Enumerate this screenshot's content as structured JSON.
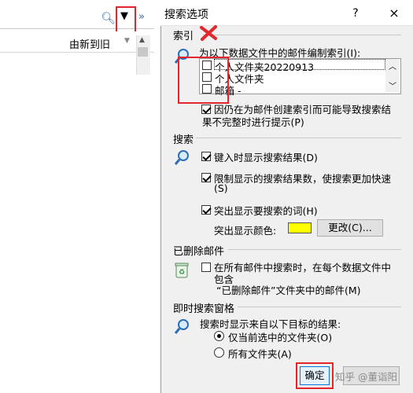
{
  "background": {
    "column_header": "由新到旧"
  },
  "dialog": {
    "title": "搜索选项",
    "help_label": "?",
    "close_label": "×",
    "index": {
      "section_title": "索引",
      "desc": "为以下数据文件中的邮件编制索引(I):",
      "items": [
        "个人文件夹20220913",
        "个人文件夹",
        "邮箱 -"
      ],
      "prompt_label": "因仍在为邮件创建索引而可能导致搜索结果不完整时进行提示(P)",
      "prompt_line1": "因仍在为邮件创建索引而可能导致搜索结",
      "prompt_line2": "果不完整时进行提示(P)"
    },
    "search": {
      "section_title": "搜索",
      "show_results_label": "键入时显示搜索结果(D)",
      "limit_line1": "限制显示的搜索结果数，使搜索更加快速",
      "limit_line2": "(S)",
      "highlight_label": "突出显示要搜索的词(H)",
      "highlight_color_label": "突出显示颜色:",
      "highlight_color": "#ffff00",
      "change_button": "更改(C)..."
    },
    "deleted": {
      "section_title": "已删除邮件",
      "line1": "在所有邮件中搜索时，在每个数据文件中",
      "line2": "包含",
      "line3": "“已删除邮件”文件夹中的邮件(M)"
    },
    "instant": {
      "section_title": "即时搜索窗格",
      "desc": "搜索时显示来自以下目标的结果:",
      "option_current": "仅当前选中的文件夹(O)",
      "option_all": "所有文件夹(A)"
    },
    "ok_button": "确定",
    "watermark": "知乎 @董诣阳"
  },
  "annotation_colors": {
    "red": "#e3262b"
  }
}
